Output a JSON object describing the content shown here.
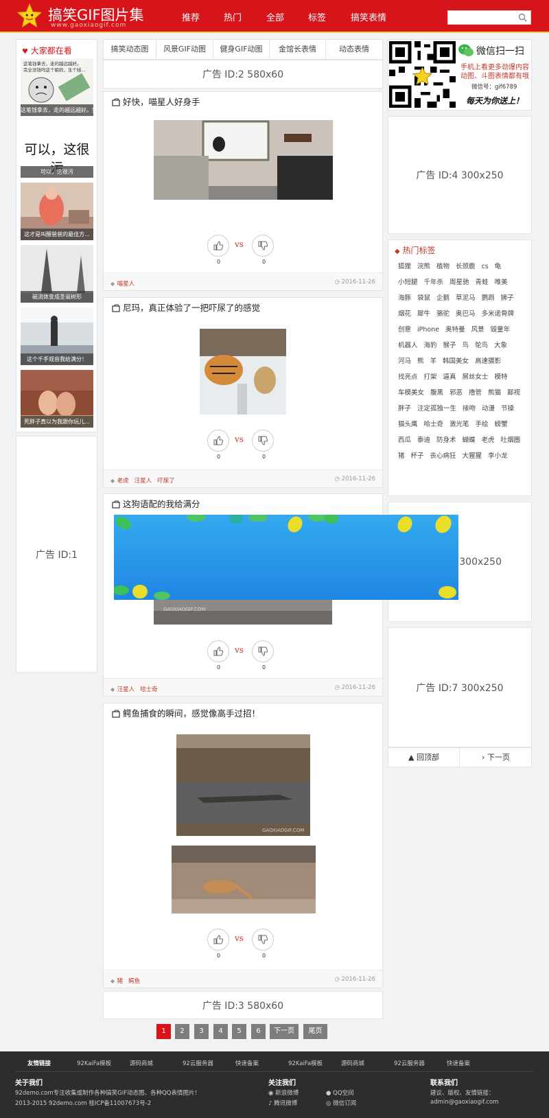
{
  "header": {
    "site_title": "搞笑GIF图片集",
    "site_url": "www.gaoxiaogif.com",
    "nav": [
      "推荐",
      "热门",
      "全部",
      "标签",
      "搞笑表情"
    ],
    "search_placeholder": ""
  },
  "left": {
    "heading": "大家都在看",
    "items": [
      {
        "caption": "这笔钱拿去，走的越远越好。完全没钱吗这个姐妈，生个娃..."
      },
      {
        "caption": "可以，这很污",
        "big": "可以，这很污"
      },
      {
        "caption": "这才是叫醒爸爸的最佳方..."
      },
      {
        "caption": "磁流体变成圣诞树形"
      },
      {
        "caption": "这个千手观音我给满分！"
      },
      {
        "caption": "死胖子真以为我跟你玩儿..."
      }
    ],
    "ad": "广告 ID:1"
  },
  "tabs": [
    "搞笑动态图",
    "风景GIF动图",
    "健身GIF动图",
    "金馆长表情",
    "动态表情"
  ],
  "ads": {
    "top": "广告 ID:2 580x60",
    "bottom": "广告 ID:3 580x60",
    "r4": "广告 ID:4 300x250",
    "r6_visible": "6 300x250",
    "r7": "广告 ID:7 300x250"
  },
  "posts": [
    {
      "title": "好快，喵星人好身手",
      "tags": [
        "喵星人"
      ],
      "date": "2016-11-26",
      "up": "0",
      "down": "0"
    },
    {
      "title": "尼玛，真正体验了一把吓尿了的感觉",
      "tags": [
        "老虎",
        "汪星人",
        "吓尿了"
      ],
      "date": "2016-11-26",
      "up": "0",
      "down": "0"
    },
    {
      "title": "这狗语配的我给满分",
      "tags": [
        "汪星人",
        "哈士奇"
      ],
      "date": "2016-11-26",
      "up": "0",
      "down": "0"
    },
    {
      "title": "鳄鱼捕食的瞬间，感觉像高手过招！",
      "tags": [
        "猪",
        "鳄鱼"
      ],
      "date": "2016-11-26",
      "up": "0",
      "down": "0"
    }
  ],
  "vs": "vs",
  "watermark": "GAOXIAOGIF.COM",
  "pagination": [
    "1",
    "2",
    "3",
    "4",
    "5",
    "6",
    "下一页",
    "尾页"
  ],
  "wechat": {
    "title": "微信扫一扫",
    "line1": "手机上看更多劲爆内容",
    "line2": "动图、斗图表情都有哦",
    "id": "微信号：gif6789",
    "slogan": "每天为你送上！"
  },
  "hot": {
    "heading": "热门标签",
    "tags": [
      "狐狸",
      "浣熊",
      "植物",
      "长颈鹿",
      "cs",
      "龟",
      "小短腿",
      "千年杀",
      "周星驰",
      "青蛙",
      "唯美",
      "海豚",
      "袋鼠",
      "企鹅",
      "草泥马",
      "鹦鹉",
      "狮子",
      "烟花",
      "犀牛",
      "骆驼",
      "奥巴马",
      "多米诺骨牌",
      "创意",
      "iPhone",
      "奥特曼",
      "风景",
      "毁童年",
      "机器人",
      "海豹",
      "猴子",
      "鸟",
      "鸵鸟",
      "大象",
      "河马",
      "熊",
      "羊",
      "韩国美女",
      "高速摄影",
      "找亮点",
      "打架",
      "逼真",
      "屌丝女士",
      "模特",
      "车模美女",
      "腹黑",
      "邪恶",
      "撸管",
      "熊猫",
      "鄙视",
      "胖子",
      "注定孤独一生",
      "接吻",
      "动漫",
      "节操",
      "猫头鹰",
      "哈士奇",
      "激光笔",
      "手绘",
      "螃蟹",
      "西瓜",
      "泰迪",
      "防身术",
      "蝴蝶",
      "老虎",
      "吐烟圈",
      "猪",
      "杯子",
      "丧心病狂",
      "大猩猩",
      "李小龙"
    ]
  },
  "rbtn": {
    "top": "回顶部",
    "next": "下一页"
  },
  "footer": {
    "links_label": "友情链接",
    "links": [
      "92KaiFa模板",
      "源码商城",
      "92云服务器",
      "快速备案",
      "92KaiFa模板",
      "源码商城",
      "92云服务器",
      "快速备案"
    ],
    "about_title": "关于我们",
    "about_text": "92demo.com专注收集或制作各种搞笑GIF动态图、各种QQ表情图片！",
    "copyright": "2013-2015 92demo.com 桂ICP备11007673号-2",
    "follow_title": "关注我们",
    "follow": [
      "新浪微博",
      "QQ空间",
      "腾讯微博",
      "微信订阅"
    ],
    "contact_title": "联系我们",
    "contact_text": "建议、版权、友情链接：",
    "email": "admin@gaoxiaogif.com"
  },
  "colors": {
    "brand": "#d8141b",
    "gold": "#f2c94c",
    "footer": "#2d2d2d"
  }
}
